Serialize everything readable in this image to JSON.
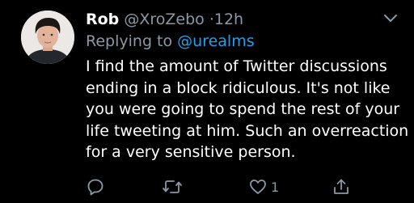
{
  "tweet": {
    "author_name": "Rob",
    "author_handle": "@XroZebo",
    "separator": "·",
    "time": "12h",
    "reply_prefix": "Replying to ",
    "reply_target": "@urealms",
    "text": "I find the amount of Twitter discussions ending in a block ridiculous. It's not like you were going to spend the rest of your life tweeting at him. Such an overreaction for a very sensitive person.",
    "like_count": "1"
  },
  "icons": {
    "menu": "chevron-down-icon",
    "reply": "reply-icon",
    "retweet": "retweet-icon",
    "like": "heart-icon",
    "share": "share-icon"
  },
  "colors": {
    "background": "#000000",
    "secondary_text": "#8b98a5",
    "link": "#1da1f2"
  }
}
